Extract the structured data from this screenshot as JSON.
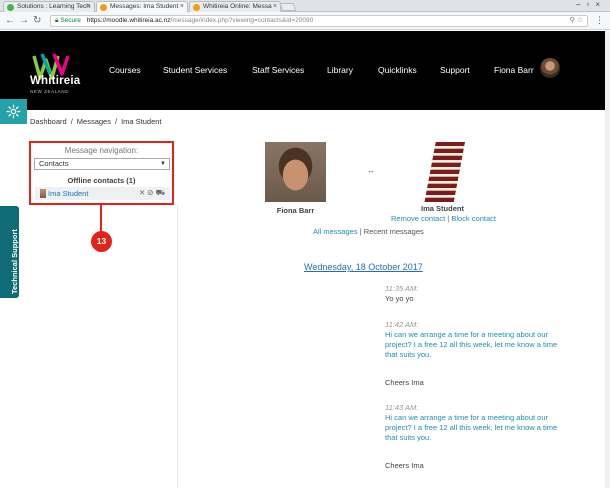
{
  "browser": {
    "tabs": [
      {
        "title": "Solutions : Learning Tech",
        "favicon_color": "#4caf50"
      },
      {
        "title": "Messages: Ima Student",
        "favicon_color": "#f39c12"
      },
      {
        "title": "Whitireia Online: Messa",
        "favicon_color": "#f39c12"
      }
    ],
    "url_secure_label": "Secure",
    "url_host": "https://moodle.whitireia.ac.nz",
    "url_path": "/message/index.php?viewing=contacts&id=20090"
  },
  "header": {
    "logo_text": "Whitireia",
    "logo_sub": "NEW ZEALAND",
    "nav": [
      "Courses",
      "Student Services",
      "Staff Services",
      "Library",
      "Quicklinks",
      "Support"
    ],
    "user_name": "Fiona Barr"
  },
  "breadcrumb": [
    "Dashboard",
    "Messages",
    "Ima Student"
  ],
  "tech_support": "Technical Support",
  "message_nav": {
    "title": "Message navigation:",
    "selected": "Contacts",
    "offline_heading": "Offline contacts (1)",
    "contact_name": "Ima Student"
  },
  "callout_number": "13",
  "conversation": {
    "me": "Fiona Barr",
    "other": "Ima Student",
    "remove_contact": "Remove contact",
    "block_contact": "Block contact",
    "all_messages": "All messages",
    "recent_messages": "Recent messages",
    "date": "Wednesday, 18 October 2017"
  },
  "messages": [
    {
      "time": "11:35 AM:",
      "text": "Yo yo yo",
      "link": false
    },
    {
      "time": "11:42 AM:",
      "text": "Hi can we arrange a time for a meeting about our project? I a free 12 all this week, let me know a time that suits you.",
      "link": true
    },
    {
      "time": "",
      "text": "Cheers Ima",
      "link": false
    },
    {
      "time": "11:43 AM:",
      "text": "Hi can we arrange a time for a meeting about our project? I a free 12 all this week, let me know a time that suits you.",
      "link": true
    },
    {
      "time": "",
      "text": "Cheers Ima",
      "link": false
    }
  ]
}
